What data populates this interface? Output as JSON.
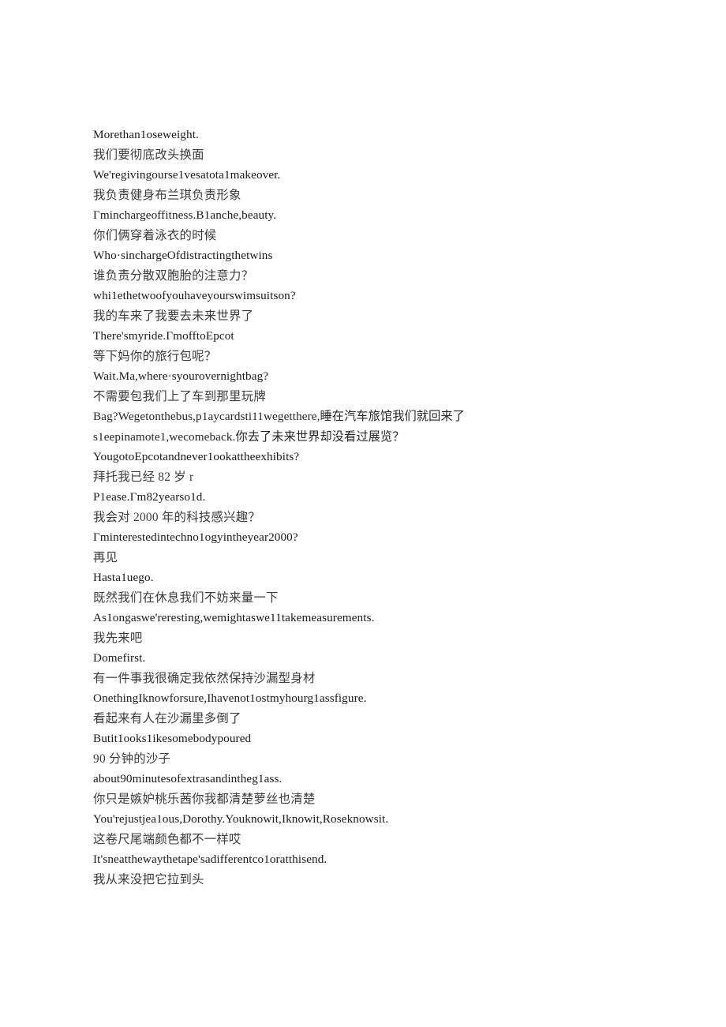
{
  "document": {
    "type": "scanned-text-page",
    "page_background": "#ffffff",
    "text_color": "#1a1a1a",
    "cjk_text_color": "#3b3b3b",
    "lines": [
      {
        "id": "l1",
        "lang": "en",
        "text": "Morethan1oseweight."
      },
      {
        "id": "l2",
        "lang": "zh",
        "text": "我们要彻底改头换面"
      },
      {
        "id": "l3",
        "lang": "en",
        "text": "We'regivingourse1vesatota1makeover."
      },
      {
        "id": "l4",
        "lang": "zh",
        "text": "我负责健身布兰琪负责形象"
      },
      {
        "id": "l5",
        "lang": "en",
        "text": "Γminchargeoffitness.B1anche,beauty."
      },
      {
        "id": "l6",
        "lang": "zh",
        "text": "你们俩穿着泳衣的时候"
      },
      {
        "id": "l7",
        "lang": "en",
        "text": "Who·sinchargeOfdistractingthetwins"
      },
      {
        "id": "l8",
        "lang": "zh",
        "text": "谁负责分散双胞胎的注意力？"
      },
      {
        "id": "l9",
        "lang": "en",
        "text": "whi1ethetwoofyouhaveyourswimsuitson?"
      },
      {
        "id": "l10",
        "lang": "zh",
        "text": "我的车来了我要去未来世界了"
      },
      {
        "id": "l11",
        "lang": "en",
        "text": "There'smyride.ΓmofftoEpcot"
      },
      {
        "id": "l12",
        "lang": "zh",
        "text": "等下妈你的旅行包呢？"
      },
      {
        "id": "l13",
        "lang": "en",
        "text": "Wait.Ma,where·syourovernightbag?"
      },
      {
        "id": "l14",
        "lang": "zh",
        "text": "不需要包我们上了车到那里玩牌"
      },
      {
        "id": "l15",
        "lang": "mixed",
        "text": "Bag?Wegetonthebus,p1aycardsti11wegetthere,睡在汽车旅馆我们就回来了"
      },
      {
        "id": "l16",
        "lang": "mixed",
        "text": "s1eepinamote1,wecomeback.你去了未来世界却没看过展览？"
      },
      {
        "id": "l17",
        "lang": "en",
        "text": "YougotoEpcotandnever1ookattheexhibits?"
      },
      {
        "id": "l18",
        "lang": "zh",
        "text": "拜托我已经 82 岁 r"
      },
      {
        "id": "l19",
        "lang": "en",
        "text": "P1ease.Γm82yearso1d."
      },
      {
        "id": "l20",
        "lang": "zh",
        "text": "我会对 2000 年的科技感兴趣？"
      },
      {
        "id": "l21",
        "lang": "en",
        "text": "Γminterestedintechno1ogyintheyear2000?"
      },
      {
        "id": "l22",
        "lang": "zh",
        "text": "再见"
      },
      {
        "id": "l23",
        "lang": "en",
        "text": "Hasta1uego."
      },
      {
        "id": "l24",
        "lang": "zh",
        "text": "既然我们在休息我们不妨来量一下"
      },
      {
        "id": "l25",
        "lang": "en",
        "text": "As1ongaswe'reresting,wemightaswe11takemeasurements."
      },
      {
        "id": "l26",
        "lang": "zh",
        "text": "我先来吧"
      },
      {
        "id": "l27",
        "lang": "en",
        "text": "Domefirst."
      },
      {
        "id": "l28",
        "lang": "zh",
        "text": "有一件事我很确定我依然保持沙漏型身材"
      },
      {
        "id": "l29",
        "lang": "en",
        "text": "OnethingIknowforsure,Ihavenot1ostmyhourg1assfigure."
      },
      {
        "id": "l30",
        "lang": "zh",
        "text": "看起来有人在沙漏里多倒了"
      },
      {
        "id": "l31",
        "lang": "en",
        "text": "Butit1ooks1ikesomebodypoured"
      },
      {
        "id": "l32",
        "lang": "zh",
        "text": "90 分钟的沙子"
      },
      {
        "id": "l33",
        "lang": "en",
        "text": "about90minutesofextrasandintheg1ass."
      },
      {
        "id": "l34",
        "lang": "zh",
        "text": "你只是嫉妒桃乐茜你我都清楚萝丝也清楚"
      },
      {
        "id": "l35",
        "lang": "en",
        "text": "You'rejustjea1ous,Dorothy.Youknowit,Iknowit,Roseknowsit."
      },
      {
        "id": "l36",
        "lang": "zh",
        "text": "这卷尺尾端颜色都不一样哎"
      },
      {
        "id": "l37",
        "lang": "en",
        "text": "It'sneatthewaythetape'sadifferentco1oratthisend."
      },
      {
        "id": "l38",
        "lang": "zh",
        "text": "我从来没把它拉到头"
      }
    ]
  }
}
